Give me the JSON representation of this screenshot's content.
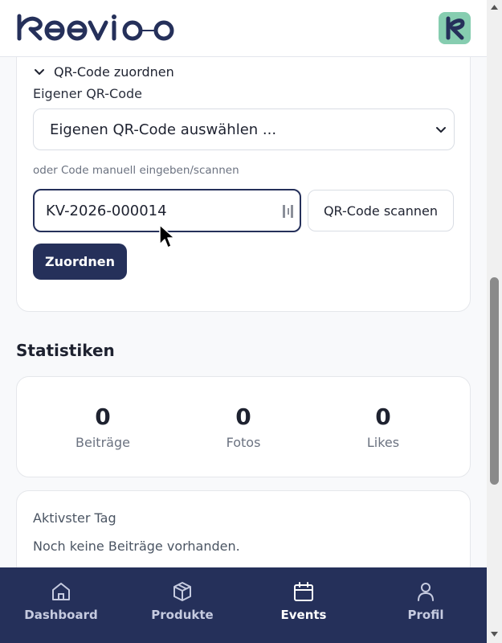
{
  "app": {
    "brand": "keevioo",
    "logo_icon": "keevioo-k-logo",
    "accent_color": "#25305a",
    "badge_color": "#86cdb0"
  },
  "qr_section": {
    "toggle_label": "QR-Code zuordnen",
    "own_code_label": "Eigener QR-Code",
    "select_value": "Eigenen QR-Code auswählen ...",
    "hint": "oder Code manuell eingeben/scannen",
    "code_value": "KV-2026-000014",
    "scan_button": "QR-Code scannen",
    "assign_button": "Zuordnen"
  },
  "statistics": {
    "title": "Statistiken",
    "items": [
      {
        "value": "0",
        "label": "Beiträge"
      },
      {
        "value": "0",
        "label": "Fotos"
      },
      {
        "value": "0",
        "label": "Likes"
      }
    ]
  },
  "active_day": {
    "title": "Aktivster Tag",
    "text": "Noch keine Beiträge vorhanden."
  },
  "nav": {
    "items": [
      {
        "label": "Dashboard",
        "icon": "home-icon"
      },
      {
        "label": "Produkte",
        "icon": "box-icon"
      },
      {
        "label": "Events",
        "icon": "calendar-icon",
        "active": true
      },
      {
        "label": "Profil",
        "icon": "user-icon"
      }
    ]
  }
}
